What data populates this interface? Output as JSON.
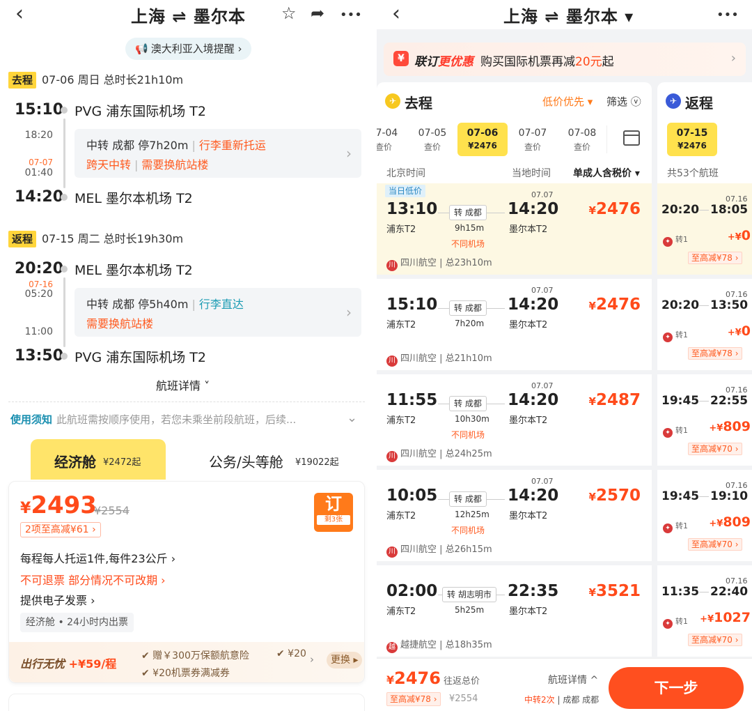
{
  "left": {
    "header": {
      "back": "‹",
      "title": "上海 ⇌ 墨尔本",
      "star": "☆",
      "share": "➦",
      "more": "•••"
    },
    "notice_pill": "澳大利亚入境提醒 ›",
    "outbound": {
      "tag": "去程",
      "meta": "07-06  周日  总时长21h10m",
      "dep_time": "15:10",
      "dep_airport": "PVG 浦东国际机场 T2",
      "mid_arr": "18:20",
      "mid_date": "07-07",
      "mid_dep": "01:40",
      "transfer_line1_a": "中转  成都  停7h20m",
      "transfer_line1_b": "行李重新托运",
      "transfer_line2_a": "跨天中转",
      "transfer_line2_b": "需要换航站楼",
      "arr_time": "14:20",
      "arr_airport": "MEL 墨尔本机场 T2"
    },
    "return": {
      "tag": "返程",
      "meta": "07-15  周二  总时长19h30m",
      "dep_time": "20:20",
      "dep_airport": "MEL 墨尔本机场 T2",
      "mid_date": "07-16",
      "mid_arr": "05:20",
      "mid_dep": "11:00",
      "transfer_line1_a": "中转  成都  停5h40m",
      "transfer_line1_b": "行李直达",
      "transfer_line2_a": "需要换航站楼",
      "arr_time": "13:50",
      "arr_airport": "PVG 浦东国际机场 T2"
    },
    "flight_detail_link": "航班详情 ˅",
    "usage_notice_title": "使用须知",
    "usage_notice_text": "此航班需按顺序使用，若您未乘坐前段航班，后续...",
    "cabin_tabs": [
      {
        "label": "经济舱",
        "price": "¥2472起"
      },
      {
        "label": "公务/头等舱",
        "price": "¥19022起"
      }
    ],
    "ticket": {
      "currency": "¥",
      "price": "2493",
      "orig_price": "¥2554",
      "discount": "2项至高减¥61 ›",
      "book_label": "订",
      "book_remaining": "剩3张",
      "baggage": "每程每人托运1件,每件23公斤 ›",
      "refund": "不可退票 部分情况不可改期 ›",
      "invoice": "提供电子发票 ›",
      "chip": "经济舱 • 24小时内出票",
      "perk_title": "出行无忧",
      "perk_price": "+¥59/程",
      "perk_item1": "✔ 赠￥300万保额航意险",
      "perk_item1_peek": "✔ ¥20",
      "perk_item2": "✔ ¥20机票券满减券",
      "perk_more": "›",
      "change_btn": "更换 ▸"
    }
  },
  "right": {
    "header": {
      "back": "‹",
      "title": "上海 ⇌ 墨尔本 ▾",
      "more": "•••"
    },
    "promo": {
      "icon": "¥",
      "brand": "联订",
      "brand2": "更优惠",
      "text_a": "购买国际机票再减",
      "text_hl": "20元",
      "text_b": "起",
      "chev": "›"
    },
    "outbound": {
      "title": "去程",
      "icon": "✈",
      "sort": "低价优先 ▾",
      "filter": "筛选 ⓥ",
      "dates": [
        {
          "d": "07-04",
          "p": "查价"
        },
        {
          "d": "07-05",
          "p": "查价"
        },
        {
          "d": "07-06",
          "p": "¥2476",
          "active": true
        },
        {
          "d": "07-07",
          "p": "查价"
        },
        {
          "d": "07-08",
          "p": "查价"
        }
      ],
      "col_beijing": "北京时间",
      "col_local": "当地时间",
      "col_price": "单成人含税价 ▾",
      "flights": [
        {
          "badge": "当日低价",
          "dep": "13:10",
          "dep_ap": "浦东T2",
          "via": "转 成都",
          "dur": "9h15m",
          "diff": "不同机场",
          "arr_date": "07.07",
          "arr": "14:20",
          "arr_ap": "墨尔本T2",
          "price": "2476",
          "airline": "四川航空 | 总23h10m",
          "logo": "川"
        },
        {
          "dep": "15:10",
          "dep_ap": "浦东T2",
          "via": "转 成都",
          "dur": "7h20m",
          "arr_date": "07.07",
          "arr": "14:20",
          "arr_ap": "墨尔本T2",
          "price": "2476",
          "airline": "四川航空 | 总21h10m",
          "logo": "川"
        },
        {
          "dep": "11:55",
          "dep_ap": "浦东T2",
          "via": "转 成都",
          "dur": "10h30m",
          "diff": "不同机场",
          "arr_date": "07.07",
          "arr": "14:20",
          "arr_ap": "墨尔本T2",
          "price": "2487",
          "airline": "四川航空 | 总24h25m",
          "logo": "川"
        },
        {
          "dep": "10:05",
          "dep_ap": "浦东T2",
          "via": "转 成都",
          "dur": "12h25m",
          "diff": "不同机场",
          "arr_date": "07.07",
          "arr": "14:20",
          "arr_ap": "墨尔本T2",
          "price": "2570",
          "airline": "四川航空 | 总26h15m",
          "logo": "川"
        },
        {
          "dep": "02:00",
          "dep_ap": "浦东T2",
          "via": "转 胡志明市",
          "dur": "5h25m",
          "arr": "22:35",
          "arr_ap": "墨尔本T2",
          "price": "3521",
          "airline": "越捷航空 | 总18h35m",
          "logo": "越"
        }
      ]
    },
    "return": {
      "title": "返程",
      "icon": "✈",
      "date": {
        "d": "07-15",
        "p": "¥2476"
      },
      "count": "共53个航班",
      "flights": [
        {
          "date": "07.16",
          "dep": "20:20",
          "arr": "18:05",
          "stop": "转1",
          "price": "0",
          "sign": "+",
          "disc": "至高减¥78 ›"
        },
        {
          "date": "07.16",
          "dep": "20:20",
          "arr": "13:50",
          "stop": "转1",
          "price": "0",
          "sign": "+",
          "disc": "至高减¥78 ›"
        },
        {
          "date": "07.16",
          "dep": "19:45",
          "arr": "22:55",
          "stop": "转1",
          "price": "809",
          "sign": "+",
          "disc": "至高减¥70 ›"
        },
        {
          "date": "07.16",
          "dep": "19:45",
          "arr": "19:10",
          "stop": "转1",
          "price": "809",
          "sign": "+",
          "disc": "至高减¥70 ›"
        },
        {
          "date": "07.16",
          "dep": "11:35",
          "arr": "22:40",
          "stop": "转1",
          "price": "1027",
          "sign": "+",
          "disc": "至高减¥70 ›"
        }
      ]
    },
    "bottom": {
      "currency": "¥",
      "price": "2476",
      "price_label": "往返总价",
      "discount": "至高减¥78 ›",
      "orig": "¥2554",
      "detail": "航班详情 ^",
      "route_red": "中转2次",
      "route": " | 成都  成都",
      "next": "下一步"
    }
  }
}
